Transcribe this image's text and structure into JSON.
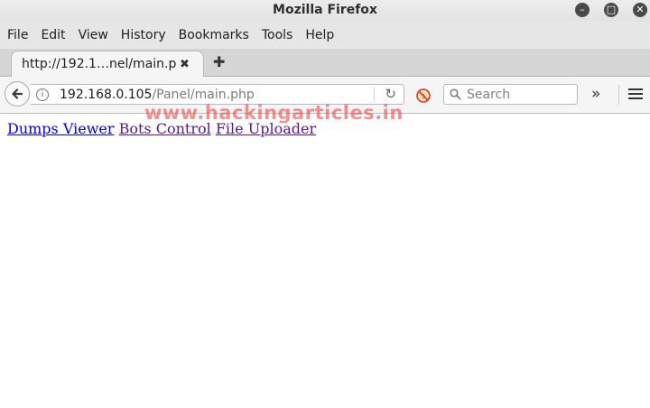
{
  "window": {
    "title": "Mozilla Firefox",
    "controls": [
      "minimize-icon",
      "maximize-icon",
      "close-icon"
    ]
  },
  "menubar": {
    "items": [
      "File",
      "Edit",
      "View",
      "History",
      "Bookmarks",
      "Tools",
      "Help"
    ]
  },
  "tabs": {
    "active_title": "http://192.1…nel/main.php",
    "close_glyph": "✖",
    "new_tab_glyph": "✚"
  },
  "navbar": {
    "url_host": "192.168.0.105",
    "url_path": "/Panel/main.php",
    "search_placeholder": "Search",
    "overflow_glyph": "»"
  },
  "page": {
    "links": [
      {
        "label": "Dumps Viewer",
        "visited": false
      },
      {
        "label": "Bots Control",
        "visited": true
      },
      {
        "label": "File Uploader",
        "visited": true
      }
    ],
    "watermark": "www.hackingarticles.in"
  },
  "colors": {
    "link": "#0000ee",
    "link_visited": "#551a8b",
    "watermark": "#e23a3a"
  }
}
